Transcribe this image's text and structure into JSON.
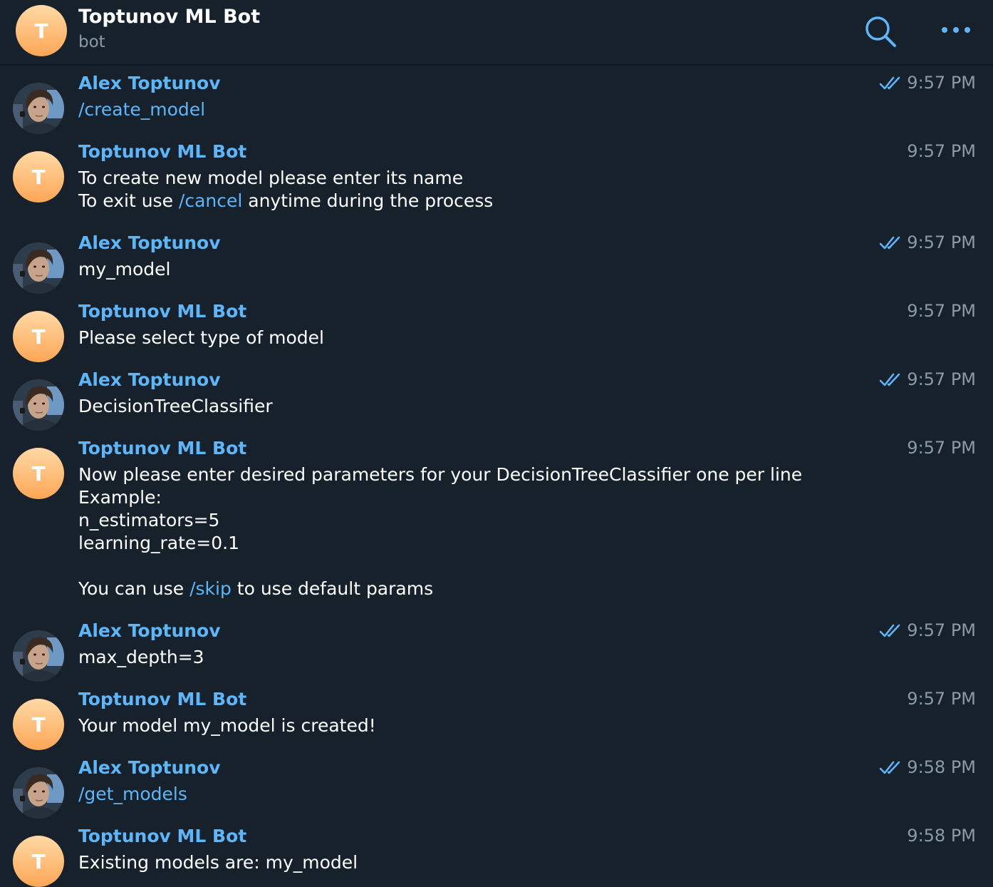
{
  "header": {
    "avatar_letter": "T",
    "title": "Toptunov ML Bot",
    "status": "bot",
    "search_icon": "search-icon",
    "more_icon": "more-horizontal-icon"
  },
  "colors": {
    "background": "#17212b",
    "accent": "#5eb5f7",
    "muted": "#8b9aa9",
    "bot_avatar_top": "#ffd9a6",
    "bot_avatar_bottom": "#fda655"
  },
  "messages": [
    {
      "sender": "Alex Toptunov",
      "is_bot": false,
      "time": "9:57 PM",
      "read": true,
      "lines": [
        [
          {
            "t": "/create_model",
            "cmd": true
          }
        ]
      ]
    },
    {
      "sender": "Toptunov ML Bot",
      "is_bot": true,
      "time": "9:57 PM",
      "read": false,
      "lines": [
        [
          {
            "t": "To create new model please enter its name"
          }
        ],
        [
          {
            "t": "To exit use "
          },
          {
            "t": "/cancel",
            "cmd": true
          },
          {
            "t": " anytime during the process"
          }
        ]
      ]
    },
    {
      "sender": "Alex Toptunov",
      "is_bot": false,
      "time": "9:57 PM",
      "read": true,
      "lines": [
        [
          {
            "t": "my_model"
          }
        ]
      ]
    },
    {
      "sender": "Toptunov ML Bot",
      "is_bot": true,
      "time": "9:57 PM",
      "read": false,
      "lines": [
        [
          {
            "t": "Please select type of model"
          }
        ]
      ]
    },
    {
      "sender": "Alex Toptunov",
      "is_bot": false,
      "time": "9:57 PM",
      "read": true,
      "lines": [
        [
          {
            "t": "DecisionTreeClassifier"
          }
        ]
      ]
    },
    {
      "sender": "Toptunov ML Bot",
      "is_bot": true,
      "time": "9:57 PM",
      "read": false,
      "lines": [
        [
          {
            "t": "Now please enter desired parameters for your DecisionTreeClassifier one per line"
          }
        ],
        [
          {
            "t": "Example:"
          }
        ],
        [
          {
            "t": "n_estimators=5"
          }
        ],
        [
          {
            "t": "learning_rate=0.1"
          }
        ],
        [],
        [
          {
            "t": "You can use "
          },
          {
            "t": "/skip",
            "cmd": true
          },
          {
            "t": " to use default params"
          }
        ]
      ]
    },
    {
      "sender": "Alex Toptunov",
      "is_bot": false,
      "time": "9:57 PM",
      "read": true,
      "lines": [
        [
          {
            "t": "max_depth=3"
          }
        ]
      ]
    },
    {
      "sender": "Toptunov ML Bot",
      "is_bot": true,
      "time": "9:57 PM",
      "read": false,
      "lines": [
        [
          {
            "t": "Your model my_model is created!"
          }
        ]
      ]
    },
    {
      "sender": "Alex Toptunov",
      "is_bot": false,
      "time": "9:58 PM",
      "read": true,
      "lines": [
        [
          {
            "t": "/get_models",
            "cmd": true
          }
        ]
      ]
    },
    {
      "sender": "Toptunov ML Bot",
      "is_bot": true,
      "time": "9:58 PM",
      "read": false,
      "lines": [
        [
          {
            "t": "Existing models are: my_model"
          }
        ]
      ]
    }
  ]
}
